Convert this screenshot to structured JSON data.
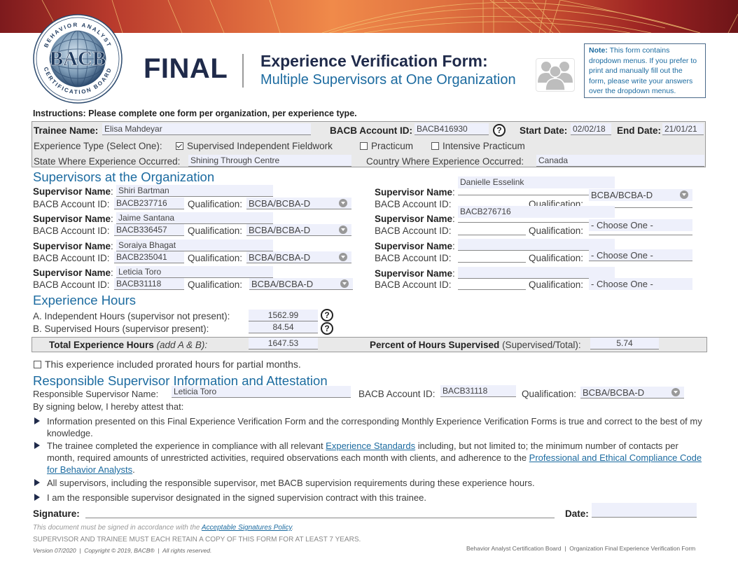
{
  "header": {
    "logo": {
      "top_arc": "BEHAVIOR ANALYST",
      "center": "BACB",
      "bottom_arc": "CERTIFICATION BOARD",
      "registered": "®"
    },
    "final_label": "FINAL",
    "form_title": "Experience Verification Form:",
    "form_subtitle": "Multiple Supervisors at One Organization",
    "note_label": "Note:",
    "note_text": " This form contains dropdown menus. If you prefer to print and manually fill out the form, please write your answers over the dropdown menus.",
    "colors": {
      "navy": "#1f2a4a",
      "blue": "#1c6ba0",
      "field_bg": "#eef0fb",
      "box_grey": "#e9e9e9"
    }
  },
  "instructions": "Instructions: Please complete one form per organization, per experience type.",
  "trainee": {
    "name_label": "Trainee Name:",
    "name_value": "Elisa Mahdeyar",
    "account_label": "BACB Account ID:",
    "account_value": "BACB416930",
    "help_glyph": "?",
    "start_label": "Start Date:",
    "start_value": "02/02/18",
    "end_label": "End Date:",
    "end_value": "21/01/21",
    "experience_type_label": "Experience Type (Select One):",
    "experience_types": [
      {
        "label": "Supervised Independent Fieldwork",
        "checked": true
      },
      {
        "label": "Practicum",
        "checked": false
      },
      {
        "label": "Intensive Practicum",
        "checked": false
      }
    ],
    "state_label": "State Where Experience Occurred:",
    "state_value": "Shining Through Centre",
    "country_label": "Country Where Experience Occurred:",
    "country_value": "Canada"
  },
  "supervisors_section": {
    "heading": "Supervisors at the Organization",
    "name_label": "Supervisor Name",
    "colon": ":",
    "account_label": "BACB Account ID:",
    "qual_label": "Qualification:",
    "left": [
      {
        "name": "Shiri Bartman",
        "account": "BACB237716",
        "qualification": "BCBA/BCBA-D"
      },
      {
        "name": "Jaime Santana",
        "account": "BACB336457",
        "qualification": "BCBA/BCBA-D"
      },
      {
        "name": "Soraiya Bhagat",
        "account": "BACB235041",
        "qualification": "BCBA/BCBA-D"
      },
      {
        "name": "Leticia Toro",
        "account": "BACB31118",
        "qualification": "BCBA/BCBA-D"
      }
    ],
    "right": [
      {
        "name": "Danielle Esselink",
        "account": "BACB276716",
        "qualification": "BCBA/BCBA-D"
      },
      {
        "name": "",
        "account": "",
        "qualification": "- Choose One -"
      },
      {
        "name": "",
        "account": "",
        "qualification": "- Choose One -"
      },
      {
        "name": "",
        "account": "",
        "qualification": "- Choose One -"
      }
    ]
  },
  "hours": {
    "heading": "Experience Hours",
    "independent_label": "A. Independent Hours (supervisor not present):",
    "independent_value": "1562.99",
    "supervised_label": "B. Supervised Hours (supervisor present):",
    "supervised_value": "84.54",
    "total_label_bold": "Total Experience Hours",
    "total_label_italic": " (add A & B):",
    "total_value": "1647.53",
    "percent_label_bold": "Percent of Hours Supervised",
    "percent_label_rest": " (Supervised/Total):",
    "percent_value": "5.74",
    "prorated_label": "This experience included prorated hours for partial months.",
    "prorated_checked": false
  },
  "attestation": {
    "heading": "Responsible Supervisor Information and Attestation",
    "resp_name_label": "Responsible Supervisor Name:",
    "resp_name_value": "Leticia Toro",
    "resp_account_label": "BACB Account ID:",
    "resp_account_value": "BACB31118",
    "resp_qual_label": "Qualification:",
    "resp_qual_value": "BCBA/BCBA-D",
    "intro": "By signing below, I hereby attest that:",
    "bullets": {
      "b1": "Information presented on this Final Experience Verification Form and the corresponding Monthly Experience Verification Forms is true and correct to the best of my knowledge.",
      "b2_pre": "The trainee completed the experience in compliance with all relevant ",
      "b2_link1": "Experience Standards",
      "b2_mid": " including, but not limited to; the minimum number of contacts per month, required amounts of unrestricted activities, required observations each month with clients, and adherence to the ",
      "b2_link2": "Professional and Ethical Compliance Code for Behavior Analysts",
      "b2_post": ".",
      "b3": "All supervisors, including the responsible supervisor, met BACB supervision requirements during these experience hours.",
      "b4": "I am the responsible supervisor designated in the signed supervision contract with this trainee."
    },
    "signature_label": "Signature:",
    "date_label": "Date:",
    "date_value": ""
  },
  "footer": {
    "policy_pre": "This document must be signed in accordance with the ",
    "policy_link": "Acceptable Signatures Policy",
    "policy_post": ".",
    "retain": "SUPERVISOR AND TRAINEE MUST EACH RETAIN A COPY OF THIS FORM FOR AT LEAST 7 YEARS.",
    "version": "Version 07/2020  |  Copyright © 2019, BACB®  |  All rights reserved.",
    "right": "Behavior Analyst Certification Board  |  Organization Final Experience Verification Form"
  }
}
